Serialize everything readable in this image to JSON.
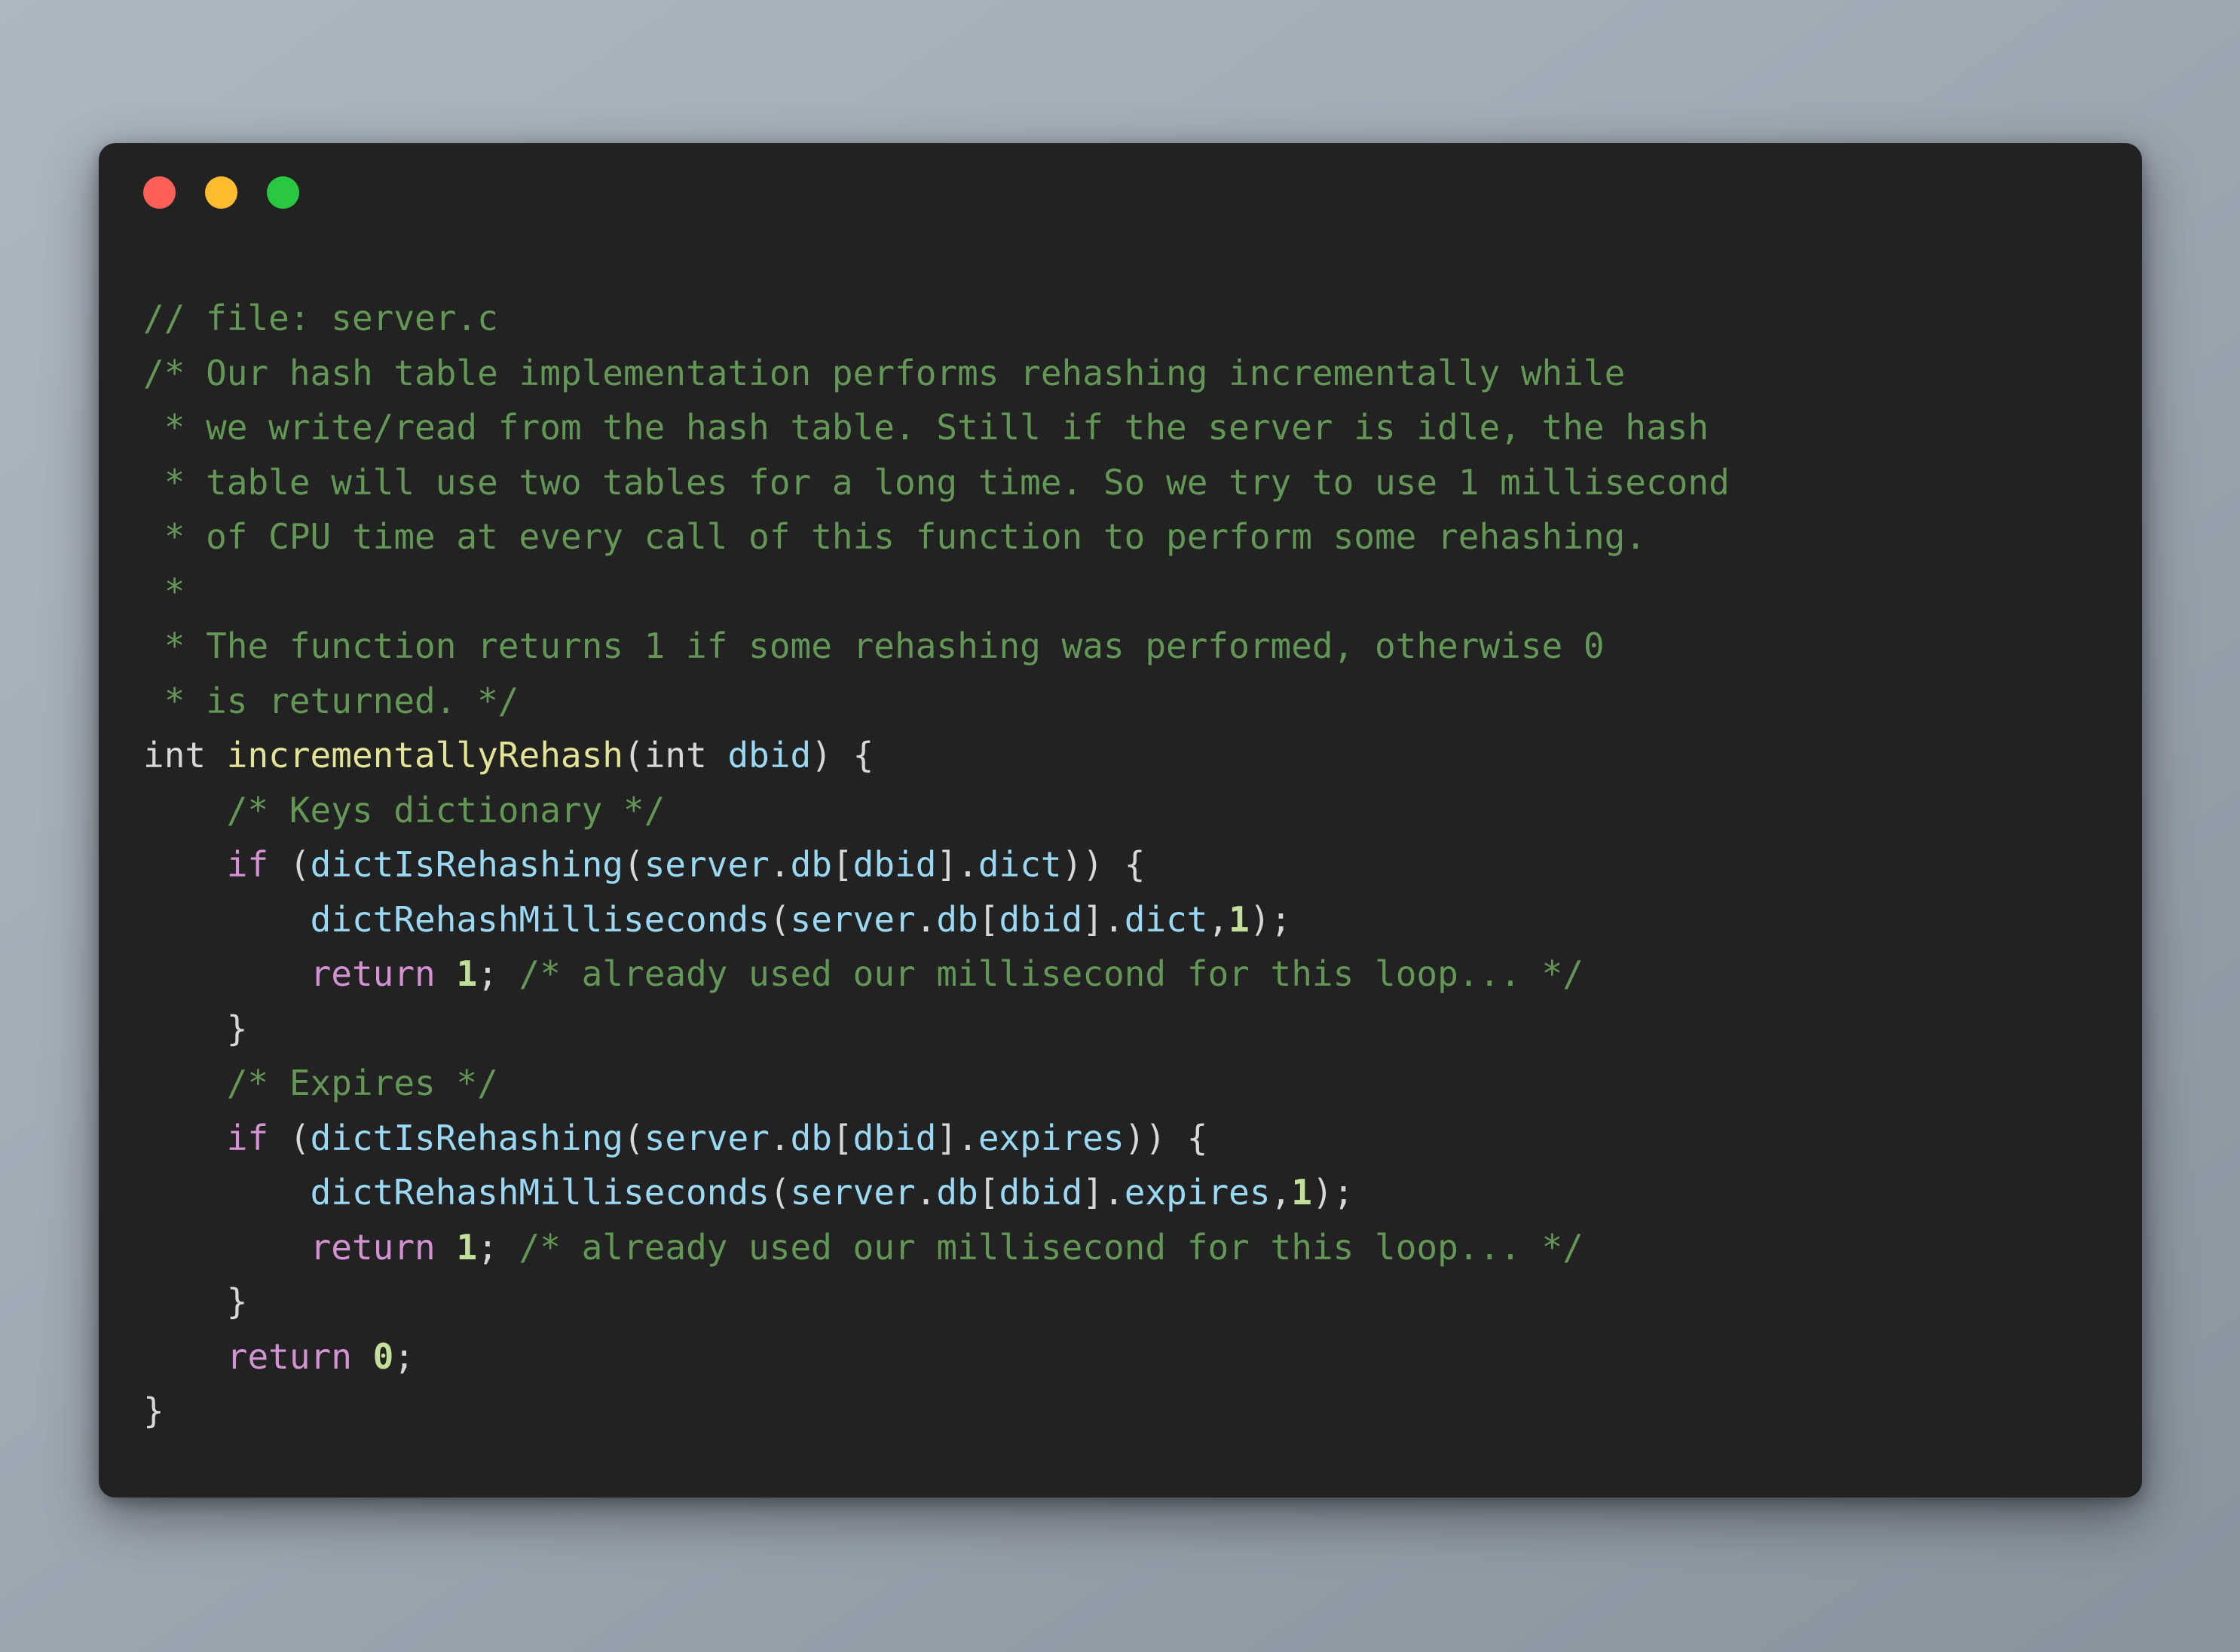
{
  "window": {
    "background_top_color": "#adb7c1",
    "background_bottom_color": "#88939e",
    "surface_color": "#222222",
    "traffic_lights": [
      {
        "name": "close",
        "label": "Close",
        "color": "#ff5f57"
      },
      {
        "name": "minimize",
        "label": "Minimize",
        "color": "#febc2e"
      },
      {
        "name": "maximize",
        "label": "Maximize",
        "color": "#28c840"
      }
    ]
  },
  "theme": {
    "comment_color": "#629755",
    "keyword_color": "#d492d4",
    "function_color": "#e2e394",
    "identifier_color": "#9ad9f5",
    "punctuation_color": "#d7d7d7",
    "number_color": "#c3e09a",
    "default_text_color": "#d4d4d4"
  },
  "code": {
    "language": "c",
    "file_name": "server.c",
    "function_name": "incrementallyRehash",
    "lines": [
      {
        "n": 1,
        "tokens": [
          {
            "t": "comment",
            "v": "// file: server.c"
          }
        ]
      },
      {
        "n": 2,
        "tokens": [
          {
            "t": "comment",
            "v": "/* Our hash table implementation performs rehashing incrementally while"
          }
        ]
      },
      {
        "n": 3,
        "tokens": [
          {
            "t": "comment",
            "v": " * we write/read from the hash table. Still if the server is idle, the hash"
          }
        ]
      },
      {
        "n": 4,
        "tokens": [
          {
            "t": "comment",
            "v": " * table will use two tables for a long time. So we try to use 1 millisecond"
          }
        ]
      },
      {
        "n": 5,
        "tokens": [
          {
            "t": "comment",
            "v": " * of CPU time at every call of this function to perform some rehashing."
          }
        ]
      },
      {
        "n": 6,
        "tokens": [
          {
            "t": "comment",
            "v": " *"
          }
        ]
      },
      {
        "n": 7,
        "tokens": [
          {
            "t": "comment",
            "v": " * The function returns 1 if some rehashing was performed, otherwise 0"
          }
        ]
      },
      {
        "n": 8,
        "tokens": [
          {
            "t": "comment",
            "v": " * is returned. */"
          }
        ]
      },
      {
        "n": 9,
        "tokens": [
          {
            "t": "type",
            "v": "int "
          },
          {
            "t": "func",
            "v": "incrementallyRehash"
          },
          {
            "t": "punct",
            "v": "("
          },
          {
            "t": "type",
            "v": "int "
          },
          {
            "t": "param",
            "v": "dbid"
          },
          {
            "t": "punct",
            "v": ") {"
          }
        ]
      },
      {
        "n": 10,
        "tokens": [
          {
            "t": "plain",
            "v": "    "
          },
          {
            "t": "comment",
            "v": "/* Keys dictionary */"
          }
        ]
      },
      {
        "n": 11,
        "tokens": [
          {
            "t": "plain",
            "v": "    "
          },
          {
            "t": "keyword",
            "v": "if"
          },
          {
            "t": "punct",
            "v": " ("
          },
          {
            "t": "ident",
            "v": "dictIsRehashing"
          },
          {
            "t": "punct",
            "v": "("
          },
          {
            "t": "ident",
            "v": "server"
          },
          {
            "t": "punct",
            "v": "."
          },
          {
            "t": "ident",
            "v": "db"
          },
          {
            "t": "punct",
            "v": "["
          },
          {
            "t": "ident",
            "v": "dbid"
          },
          {
            "t": "punct",
            "v": "]."
          },
          {
            "t": "ident",
            "v": "dict"
          },
          {
            "t": "punct",
            "v": ")) {"
          }
        ]
      },
      {
        "n": 12,
        "tokens": [
          {
            "t": "plain",
            "v": "        "
          },
          {
            "t": "ident",
            "v": "dictRehashMilliseconds"
          },
          {
            "t": "punct",
            "v": "("
          },
          {
            "t": "ident",
            "v": "server"
          },
          {
            "t": "punct",
            "v": "."
          },
          {
            "t": "ident",
            "v": "db"
          },
          {
            "t": "punct",
            "v": "["
          },
          {
            "t": "ident",
            "v": "dbid"
          },
          {
            "t": "punct",
            "v": "]."
          },
          {
            "t": "ident",
            "v": "dict"
          },
          {
            "t": "punct",
            "v": ","
          },
          {
            "t": "number",
            "v": "1"
          },
          {
            "t": "punct",
            "v": ");"
          }
        ]
      },
      {
        "n": 13,
        "tokens": [
          {
            "t": "plain",
            "v": "        "
          },
          {
            "t": "keyword",
            "v": "return"
          },
          {
            "t": "plain",
            "v": " "
          },
          {
            "t": "number",
            "v": "1"
          },
          {
            "t": "punct",
            "v": "; "
          },
          {
            "t": "comment",
            "v": "/* already used our millisecond for this loop... */"
          }
        ]
      },
      {
        "n": 14,
        "tokens": [
          {
            "t": "plain",
            "v": "    "
          },
          {
            "t": "punct",
            "v": "}"
          }
        ]
      },
      {
        "n": 15,
        "tokens": [
          {
            "t": "plain",
            "v": "    "
          },
          {
            "t": "comment",
            "v": "/* Expires */"
          }
        ]
      },
      {
        "n": 16,
        "tokens": [
          {
            "t": "plain",
            "v": "    "
          },
          {
            "t": "keyword",
            "v": "if"
          },
          {
            "t": "punct",
            "v": " ("
          },
          {
            "t": "ident",
            "v": "dictIsRehashing"
          },
          {
            "t": "punct",
            "v": "("
          },
          {
            "t": "ident",
            "v": "server"
          },
          {
            "t": "punct",
            "v": "."
          },
          {
            "t": "ident",
            "v": "db"
          },
          {
            "t": "punct",
            "v": "["
          },
          {
            "t": "ident",
            "v": "dbid"
          },
          {
            "t": "punct",
            "v": "]."
          },
          {
            "t": "ident",
            "v": "expires"
          },
          {
            "t": "punct",
            "v": ")) {"
          }
        ]
      },
      {
        "n": 17,
        "tokens": [
          {
            "t": "plain",
            "v": "        "
          },
          {
            "t": "ident",
            "v": "dictRehashMilliseconds"
          },
          {
            "t": "punct",
            "v": "("
          },
          {
            "t": "ident",
            "v": "server"
          },
          {
            "t": "punct",
            "v": "."
          },
          {
            "t": "ident",
            "v": "db"
          },
          {
            "t": "punct",
            "v": "["
          },
          {
            "t": "ident",
            "v": "dbid"
          },
          {
            "t": "punct",
            "v": "]."
          },
          {
            "t": "ident",
            "v": "expires"
          },
          {
            "t": "punct",
            "v": ","
          },
          {
            "t": "number",
            "v": "1"
          },
          {
            "t": "punct",
            "v": ");"
          }
        ]
      },
      {
        "n": 18,
        "tokens": [
          {
            "t": "plain",
            "v": "        "
          },
          {
            "t": "keyword",
            "v": "return"
          },
          {
            "t": "plain",
            "v": " "
          },
          {
            "t": "number",
            "v": "1"
          },
          {
            "t": "punct",
            "v": "; "
          },
          {
            "t": "comment",
            "v": "/* already used our millisecond for this loop... */"
          }
        ]
      },
      {
        "n": 19,
        "tokens": [
          {
            "t": "plain",
            "v": "    "
          },
          {
            "t": "punct",
            "v": "}"
          }
        ]
      },
      {
        "n": 20,
        "tokens": [
          {
            "t": "plain",
            "v": "    "
          },
          {
            "t": "keyword",
            "v": "return"
          },
          {
            "t": "plain",
            "v": " "
          },
          {
            "t": "number",
            "v": "0"
          },
          {
            "t": "punct",
            "v": ";"
          }
        ]
      },
      {
        "n": 21,
        "tokens": [
          {
            "t": "punct",
            "v": "}"
          }
        ]
      }
    ]
  }
}
